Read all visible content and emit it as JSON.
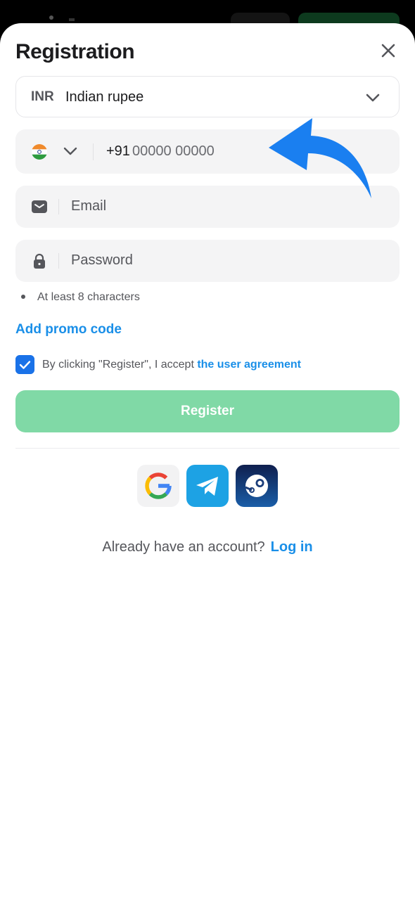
{
  "header": {
    "title": "Registration"
  },
  "currency": {
    "code": "INR",
    "name": "Indian rupee"
  },
  "phone": {
    "prefix": "+91",
    "placeholder": "00000 00000"
  },
  "email": {
    "placeholder": "Email"
  },
  "password": {
    "placeholder": "Password",
    "hint": "At least 8 characters"
  },
  "promo": {
    "label": "Add promo code"
  },
  "agreement": {
    "text": "By clicking \"Register\", I accept ",
    "link": "the user agreement",
    "checked": true
  },
  "register": {
    "label": "Register"
  },
  "social": [
    "google-icon",
    "telegram-icon",
    "steam-icon"
  ],
  "footer": {
    "question": "Already have an account?",
    "login": "Log in"
  },
  "colors": {
    "accent": "#1a8fe8",
    "register_bg": "#80d9a6",
    "checkbox": "#1a72e8",
    "annotation_arrow": "#1a7ff0"
  }
}
